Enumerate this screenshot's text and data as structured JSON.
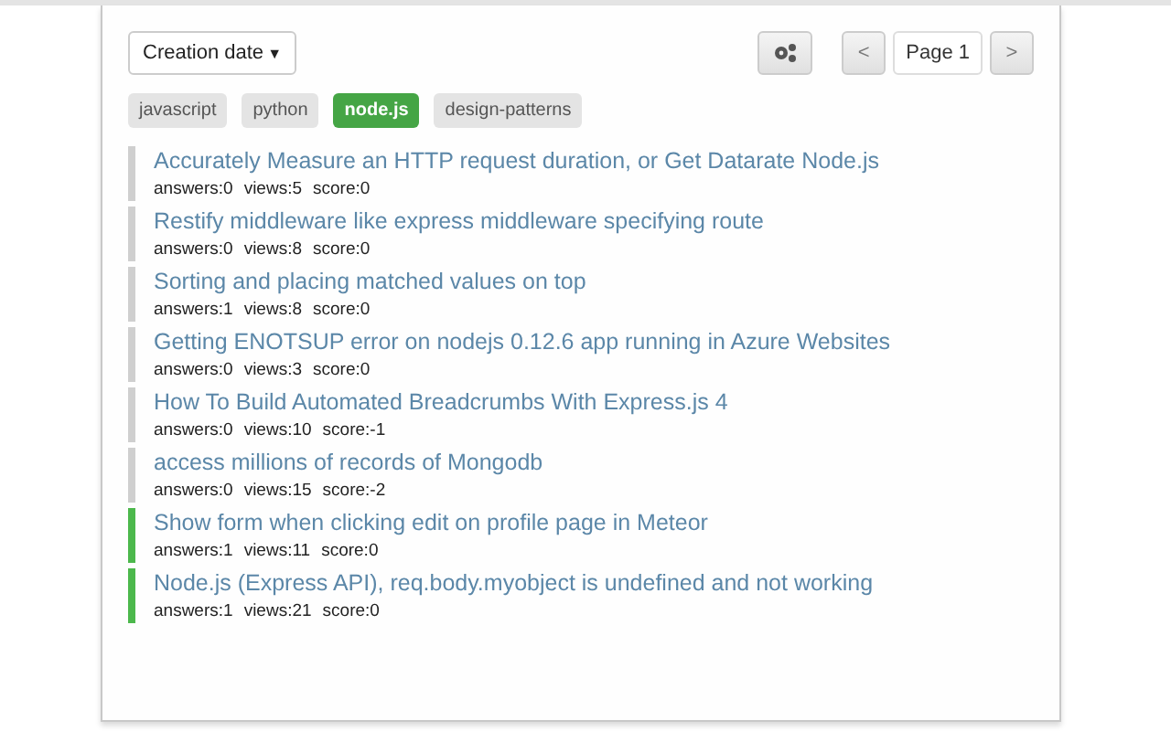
{
  "sort_select": {
    "value": "Creation date",
    "caret": "▼"
  },
  "pager": {
    "prev": "<",
    "page": "Page 1",
    "next": ">"
  },
  "tags": [
    {
      "label": "javascript",
      "selected": false
    },
    {
      "label": "python",
      "selected": false
    },
    {
      "label": "node.js",
      "selected": true
    },
    {
      "label": "design-patterns",
      "selected": false
    }
  ],
  "questions": [
    {
      "title": "Accurately Measure an HTTP request duration, or Get Datarate Node.js",
      "answers": "answers:0",
      "views": "views:5",
      "score": "score:0",
      "answered": false
    },
    {
      "title": "Restify middleware like express middleware specifying route",
      "answers": "answers:0",
      "views": "views:8",
      "score": "score:0",
      "answered": false
    },
    {
      "title": "Sorting and placing matched values on top",
      "answers": "answers:1",
      "views": "views:8",
      "score": "score:0",
      "answered": false
    },
    {
      "title": "Getting ENOTSUP error on nodejs 0.12.6 app running in Azure Websites",
      "answers": "answers:0",
      "views": "views:3",
      "score": "score:0",
      "answered": false
    },
    {
      "title": "How To Build Automated Breadcrumbs With Express.js 4",
      "answers": "answers:0",
      "views": "views:10",
      "score": "score:-1",
      "answered": false
    },
    {
      "title": "access millions of records of Mongodb",
      "answers": "answers:0",
      "views": "views:15",
      "score": "score:-2",
      "answered": false
    },
    {
      "title": "Show form when clicking edit on profile page in Meteor",
      "answers": "answers:1",
      "views": "views:11",
      "score": "score:0",
      "answered": true
    },
    {
      "title": "Node.js (Express API), req.body.myobject is undefined and not working",
      "answers": "answers:1",
      "views": "views:21",
      "score": "score:0",
      "answered": true
    }
  ]
}
